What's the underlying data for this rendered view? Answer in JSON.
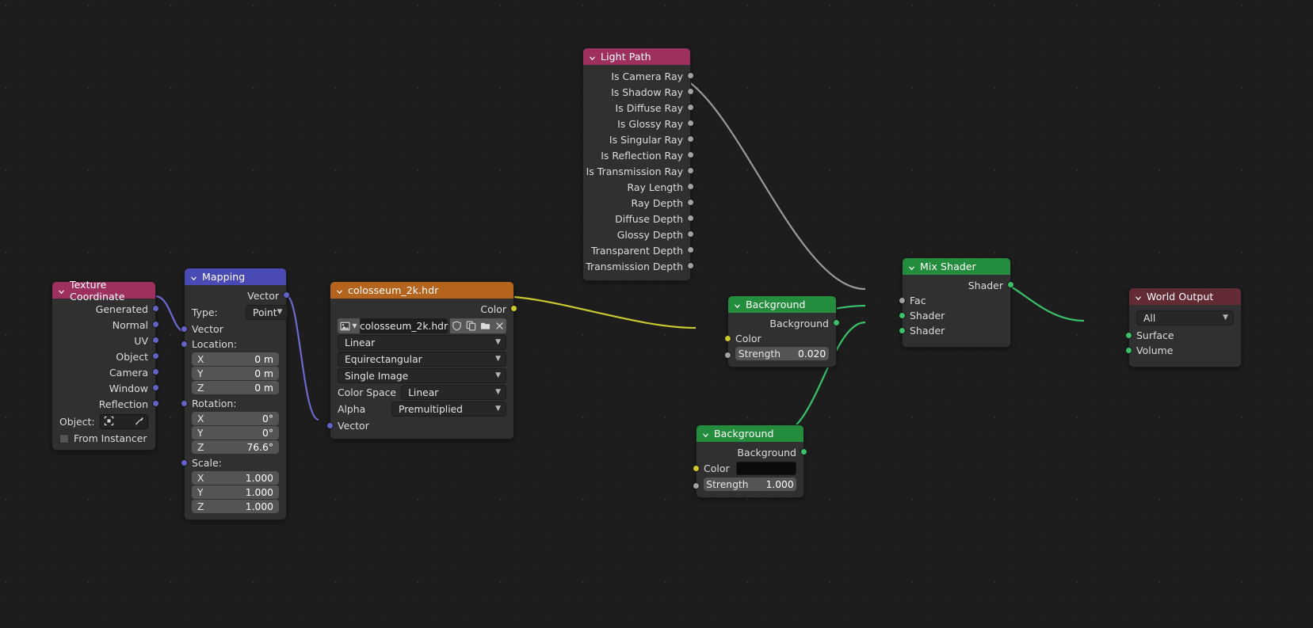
{
  "editor": {
    "name": "blender-shader-node-editor",
    "background_color": "#1d1d1d"
  },
  "colors": {
    "header_red": "#9e3060",
    "header_darkred": "#632b34",
    "header_blue": "#4a4ab5",
    "header_orange": "#b5641e",
    "header_green": "#248c3d",
    "socket_gray": "#a1a1a1",
    "socket_green": "#3ac06a",
    "socket_yellow": "#ccc92a",
    "socket_purple": "#6363c7",
    "wire_yellow": "#c8c832",
    "wire_green": "#3ac06a",
    "wire_purple": "#6a6ad0",
    "wire_gray": "#9a9a9a"
  },
  "nodes": {
    "texture_coordinate": {
      "title": "Texture Coordinate",
      "outputs": [
        "Generated",
        "Normal",
        "UV",
        "Object",
        "Camera",
        "Window",
        "Reflection"
      ],
      "object_label": "Object:",
      "object_value": "",
      "from_instancer_label": "From Instancer"
    },
    "mapping": {
      "title": "Mapping",
      "output": "Vector",
      "type_label": "Type:",
      "type_value": "Point",
      "vector_input": "Vector",
      "location_label": "Location:",
      "location": [
        {
          "axis": "X",
          "value": "0 m"
        },
        {
          "axis": "Y",
          "value": "0 m"
        },
        {
          "axis": "Z",
          "value": "0 m"
        }
      ],
      "rotation_label": "Rotation:",
      "rotation": [
        {
          "axis": "X",
          "value": "0°"
        },
        {
          "axis": "Y",
          "value": "0°"
        },
        {
          "axis": "Z",
          "value": "76.6°"
        }
      ],
      "scale_label": "Scale:",
      "scale": [
        {
          "axis": "X",
          "value": "1.000"
        },
        {
          "axis": "Y",
          "value": "1.000"
        },
        {
          "axis": "Z",
          "value": "1.000"
        }
      ]
    },
    "environment_texture": {
      "title": "colosseum_2k.hdr",
      "output": "Color",
      "image_name": "colosseum_2k.hdr",
      "interpolation": "Linear",
      "projection": "Equirectangular",
      "source": "Single Image",
      "color_space_label": "Color Space",
      "color_space_value": "Linear",
      "alpha_label": "Alpha",
      "alpha_value": "Premultiplied",
      "vector_input": "Vector"
    },
    "light_path": {
      "title": "Light Path",
      "outputs": [
        "Is Camera Ray",
        "Is Shadow Ray",
        "Is Diffuse Ray",
        "Is Glossy Ray",
        "Is Singular Ray",
        "Is Reflection Ray",
        "Is Transmission Ray",
        "Ray Length",
        "Ray Depth",
        "Diffuse Depth",
        "Glossy Depth",
        "Transparent Depth",
        "Transmission Depth"
      ]
    },
    "background_top": {
      "title": "Background",
      "output": "Background",
      "color_label": "Color",
      "strength_label": "Strength",
      "strength_value": "0.020"
    },
    "background_bottom": {
      "title": "Background",
      "output": "Background",
      "color_label": "Color",
      "color_value": "#000000",
      "strength_label": "Strength",
      "strength_value": "1.000"
    },
    "mix_shader": {
      "title": "Mix Shader",
      "output": "Shader",
      "inputs": [
        "Fac",
        "Shader",
        "Shader"
      ]
    },
    "world_output": {
      "title": "World Output",
      "target": "All",
      "inputs": [
        "Surface",
        "Volume"
      ]
    }
  }
}
